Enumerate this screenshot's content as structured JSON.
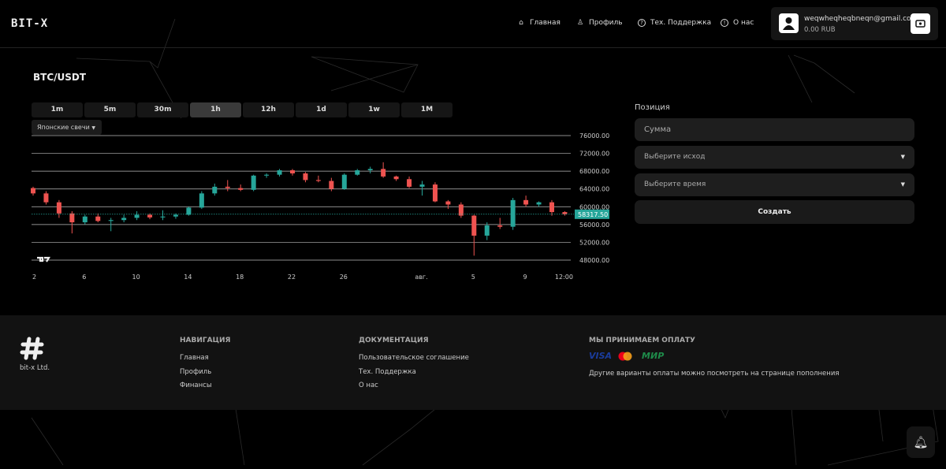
{
  "header": {
    "logo": "BIT-X",
    "nav": [
      {
        "label": "Главная",
        "icon": "home-icon"
      },
      {
        "label": "Профиль",
        "icon": "user-icon"
      },
      {
        "label": "Тех. Поддержка",
        "icon": "help-icon"
      },
      {
        "label": "О нас",
        "icon": "info-icon"
      }
    ],
    "account": {
      "email": "weqwheqheqbneqn@gmail.com",
      "balance": "0.00 RUB"
    }
  },
  "main": {
    "pair": "BTC/USDT",
    "timeframes": [
      "1m",
      "5m",
      "30m",
      "1h",
      "12h",
      "1d",
      "1w",
      "1M"
    ],
    "active_timeframe": "1h",
    "chart_type": "Японские свечи"
  },
  "position": {
    "label": "Позиция",
    "amount_placeholder": "Сумма",
    "outcome_placeholder": "Выберите исход",
    "time_placeholder": "Выберите время",
    "create": "Создать"
  },
  "chart_data": {
    "type": "candlestick",
    "interval": "1h",
    "y_ticks": [
      "48000.00",
      "52000.00",
      "56000.00",
      "60000.00",
      "64000.00",
      "68000.00",
      "72000.00",
      "76000.00"
    ],
    "ylim": [
      48000,
      76000
    ],
    "x_ticks": [
      {
        "label": "2",
        "day": 0
      },
      {
        "label": "6",
        "day": 4
      },
      {
        "label": "10",
        "day": 8
      },
      {
        "label": "14",
        "day": 12
      },
      {
        "label": "18",
        "day": 16
      },
      {
        "label": "22",
        "day": 20
      },
      {
        "label": "26",
        "day": 24
      },
      {
        "label": "авг.",
        "day": 30
      },
      {
        "label": "5",
        "day": 34
      },
      {
        "label": "9",
        "day": 38
      },
      {
        "label": "12:00",
        "day": 41
      }
    ],
    "last_price": "58317.50",
    "last_price_value": 58317.5,
    "colors": {
      "up": "#26a69a",
      "down": "#ef5350"
    },
    "ohlc_daily_approx": [
      [
        64200,
        64500,
        62500,
        63000
      ],
      [
        63000,
        63500,
        60500,
        61000
      ],
      [
        61000,
        61500,
        57500,
        58500
      ],
      [
        58500,
        59000,
        54000,
        56500
      ],
      [
        56500,
        58200,
        56000,
        57800
      ],
      [
        57800,
        58500,
        56500,
        56800
      ],
      [
        56800,
        57500,
        54500,
        57000
      ],
      [
        57000,
        58200,
        56500,
        57500
      ],
      [
        57500,
        59000,
        57000,
        58200
      ],
      [
        58200,
        58500,
        57200,
        57600
      ],
      [
        57600,
        59200,
        57000,
        57800
      ],
      [
        57800,
        58500,
        57300,
        58200
      ],
      [
        58200,
        60000,
        58000,
        59800
      ],
      [
        59800,
        63500,
        59500,
        63000
      ],
      [
        63000,
        65200,
        62500,
        64500
      ],
      [
        64500,
        66000,
        63500,
        64200
      ],
      [
        64200,
        65000,
        63500,
        63800
      ],
      [
        63800,
        67200,
        63500,
        67000
      ],
      [
        67000,
        67500,
        66500,
        67200
      ],
      [
        67200,
        68500,
        66800,
        68200
      ],
      [
        68200,
        68500,
        67000,
        67500
      ],
      [
        67500,
        67800,
        65500,
        66000
      ],
      [
        66000,
        67000,
        65500,
        65800
      ],
      [
        65800,
        66500,
        63500,
        64000
      ],
      [
        64000,
        67500,
        63800,
        67200
      ],
      [
        67200,
        68500,
        67000,
        68200
      ],
      [
        68200,
        69000,
        67500,
        68500
      ],
      [
        68500,
        70000,
        66500,
        66800
      ],
      [
        66800,
        67000,
        65800,
        66200
      ],
      [
        66200,
        66800,
        64200,
        64500
      ],
      [
        64500,
        65800,
        62500,
        65000
      ],
      [
        65000,
        65500,
        61000,
        61200
      ],
      [
        61200,
        61500,
        59500,
        60500
      ],
      [
        60500,
        61000,
        57500,
        58000
      ],
      [
        58000,
        58200,
        49000,
        53500
      ],
      [
        53500,
        56500,
        52500,
        55800
      ],
      [
        55800,
        57500,
        55000,
        55500
      ],
      [
        55500,
        62000,
        54800,
        61500
      ],
      [
        61500,
        62500,
        60000,
        60500
      ],
      [
        60500,
        61200,
        60000,
        61000
      ],
      [
        61000,
        61500,
        58000,
        58800
      ],
      [
        58800,
        59000,
        58000,
        58317.5
      ]
    ]
  },
  "footer": {
    "company": "bit-x Ltd.",
    "nav_title": "НАВИГАЦИЯ",
    "nav": [
      "Главная",
      "Профиль",
      "Финансы"
    ],
    "docs_title": "ДОКУМЕНТАЦИЯ",
    "docs": [
      "Пользовательское соглашение",
      "Тех. Поддержка",
      "О нас"
    ],
    "pay_title": "МЫ ПРИНИМАЕМ ОПЛАТУ",
    "pay_logos": [
      "VISA",
      "Mastercard",
      "МИР"
    ],
    "pay_note": "Другие варианты оплаты можно посмотреть на странице пополнения"
  }
}
